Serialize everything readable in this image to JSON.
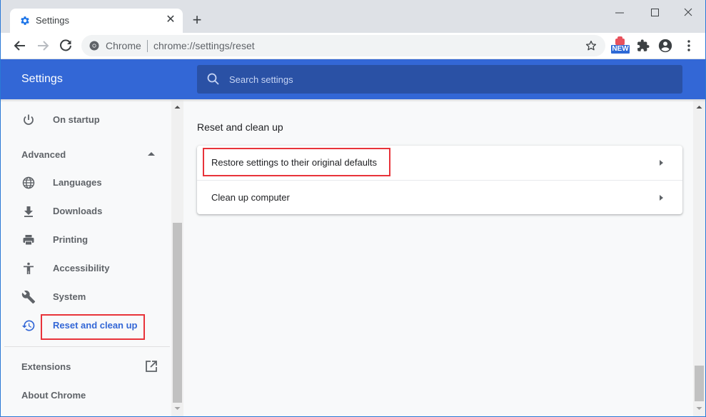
{
  "browser": {
    "tab": {
      "title": "Settings",
      "icon": "gear-icon",
      "close_icon": "close-icon"
    },
    "new_tab_icon": "plus-icon",
    "window_controls": {
      "minimize": "minimize-icon",
      "maximize": "maximize-icon",
      "close": "close-icon"
    },
    "toolbar": {
      "back_icon": "arrow-left-icon",
      "forward_icon": "arrow-right-icon",
      "reload_icon": "reload-icon",
      "site_name": "Chrome",
      "url": "chrome://settings/reset",
      "bookmark_icon": "star-icon",
      "extension_badge": "NEW",
      "extensions_icon": "puzzle-icon",
      "profile_icon": "account-circle-icon",
      "menu_icon": "more-vert-icon"
    }
  },
  "settings": {
    "header_title": "Settings",
    "search_placeholder": "Search settings",
    "sidebar": {
      "on_startup": "On startup",
      "advanced": "Advanced",
      "items": [
        {
          "label": "Languages",
          "icon": "globe-icon"
        },
        {
          "label": "Downloads",
          "icon": "download-icon"
        },
        {
          "label": "Printing",
          "icon": "printer-icon"
        },
        {
          "label": "Accessibility",
          "icon": "accessibility-icon"
        },
        {
          "label": "System",
          "icon": "wrench-icon"
        },
        {
          "label": "Reset and clean up",
          "icon": "restore-icon",
          "active": true
        }
      ],
      "extensions": "Extensions",
      "about": "About Chrome"
    },
    "main": {
      "section_title": "Reset and clean up",
      "rows": [
        {
          "label": "Restore settings to their original defaults",
          "highlighted": true
        },
        {
          "label": "Clean up computer"
        }
      ]
    }
  },
  "colors": {
    "accent": "#3367d6",
    "search_bg": "#2a51a5",
    "highlight_box": "#e8333a"
  }
}
